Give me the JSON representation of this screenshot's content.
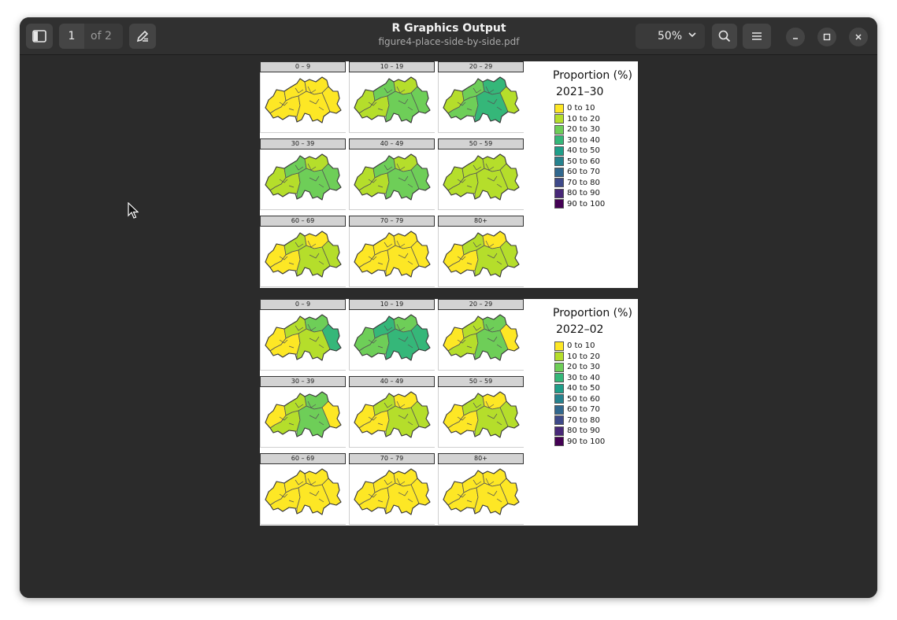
{
  "app": {
    "title": "R Graphics Output",
    "filename": "figure4-place-side-by-side.pdf",
    "current_page": "1",
    "page_total": "of 2",
    "zoom": "50%"
  },
  "icons": {
    "sidebar": "sidebar-toggle-icon",
    "annotate": "pen-icon",
    "zoom_dropdown": "chevron-down-icon",
    "search": "search-icon",
    "menu": "hamburger-menu-icon",
    "minimize": "minimize-icon",
    "maximize": "maximize-icon",
    "close": "close-icon"
  },
  "palette": [
    "#FDE725",
    "#B5DE2B",
    "#6ECE58",
    "#35B779",
    "#1F9E89",
    "#26828E",
    "#31688E",
    "#3E4989",
    "#482878",
    "#440154"
  ],
  "legend": {
    "title": "Proportion (%)",
    "items": [
      "0 to 10",
      "10 to 20",
      "20 to 30",
      "30 to 40",
      "40 to 50",
      "50 to 60",
      "60 to 70",
      "70 to 80",
      "80 to 90",
      "90 to 100"
    ]
  },
  "age_groups": [
    "0 – 9",
    "10 – 19",
    "20 – 29",
    "30 – 39",
    "40 – 49",
    "50 – 59",
    "60 – 69",
    "70 – 79",
    "80+"
  ],
  "pages": [
    {
      "period": "2021–30",
      "panel_fill_levels": [
        [
          "0 to 10"
        ],
        [
          "10 to 20",
          "20 to 30"
        ],
        [
          "10 to 20",
          "20 to 30",
          "30 to 40"
        ],
        [
          "10 to 20",
          "20 to 30"
        ],
        [
          "10 to 20",
          "20 to 30"
        ],
        [
          "10 to 20"
        ],
        [
          "0 to 10",
          "10 to 20"
        ],
        [
          "0 to 10"
        ],
        [
          "0 to 10",
          "10 to 20"
        ]
      ]
    },
    {
      "period": "2022–02",
      "panel_fill_levels": [
        [
          "0 to 10",
          "10 to 20",
          "20 to 30",
          "30 to 40"
        ],
        [
          "20 to 30",
          "30 to 40"
        ],
        [
          "0 to 10",
          "10 to 20",
          "20 to 30"
        ],
        [
          "0 to 10",
          "10 to 20",
          "20 to 30"
        ],
        [
          "0 to 10",
          "10 to 20"
        ],
        [
          "0 to 10",
          "10 to 20"
        ],
        [
          "0 to 10"
        ],
        [
          "0 to 10"
        ],
        [
          "0 to 10"
        ]
      ]
    }
  ]
}
